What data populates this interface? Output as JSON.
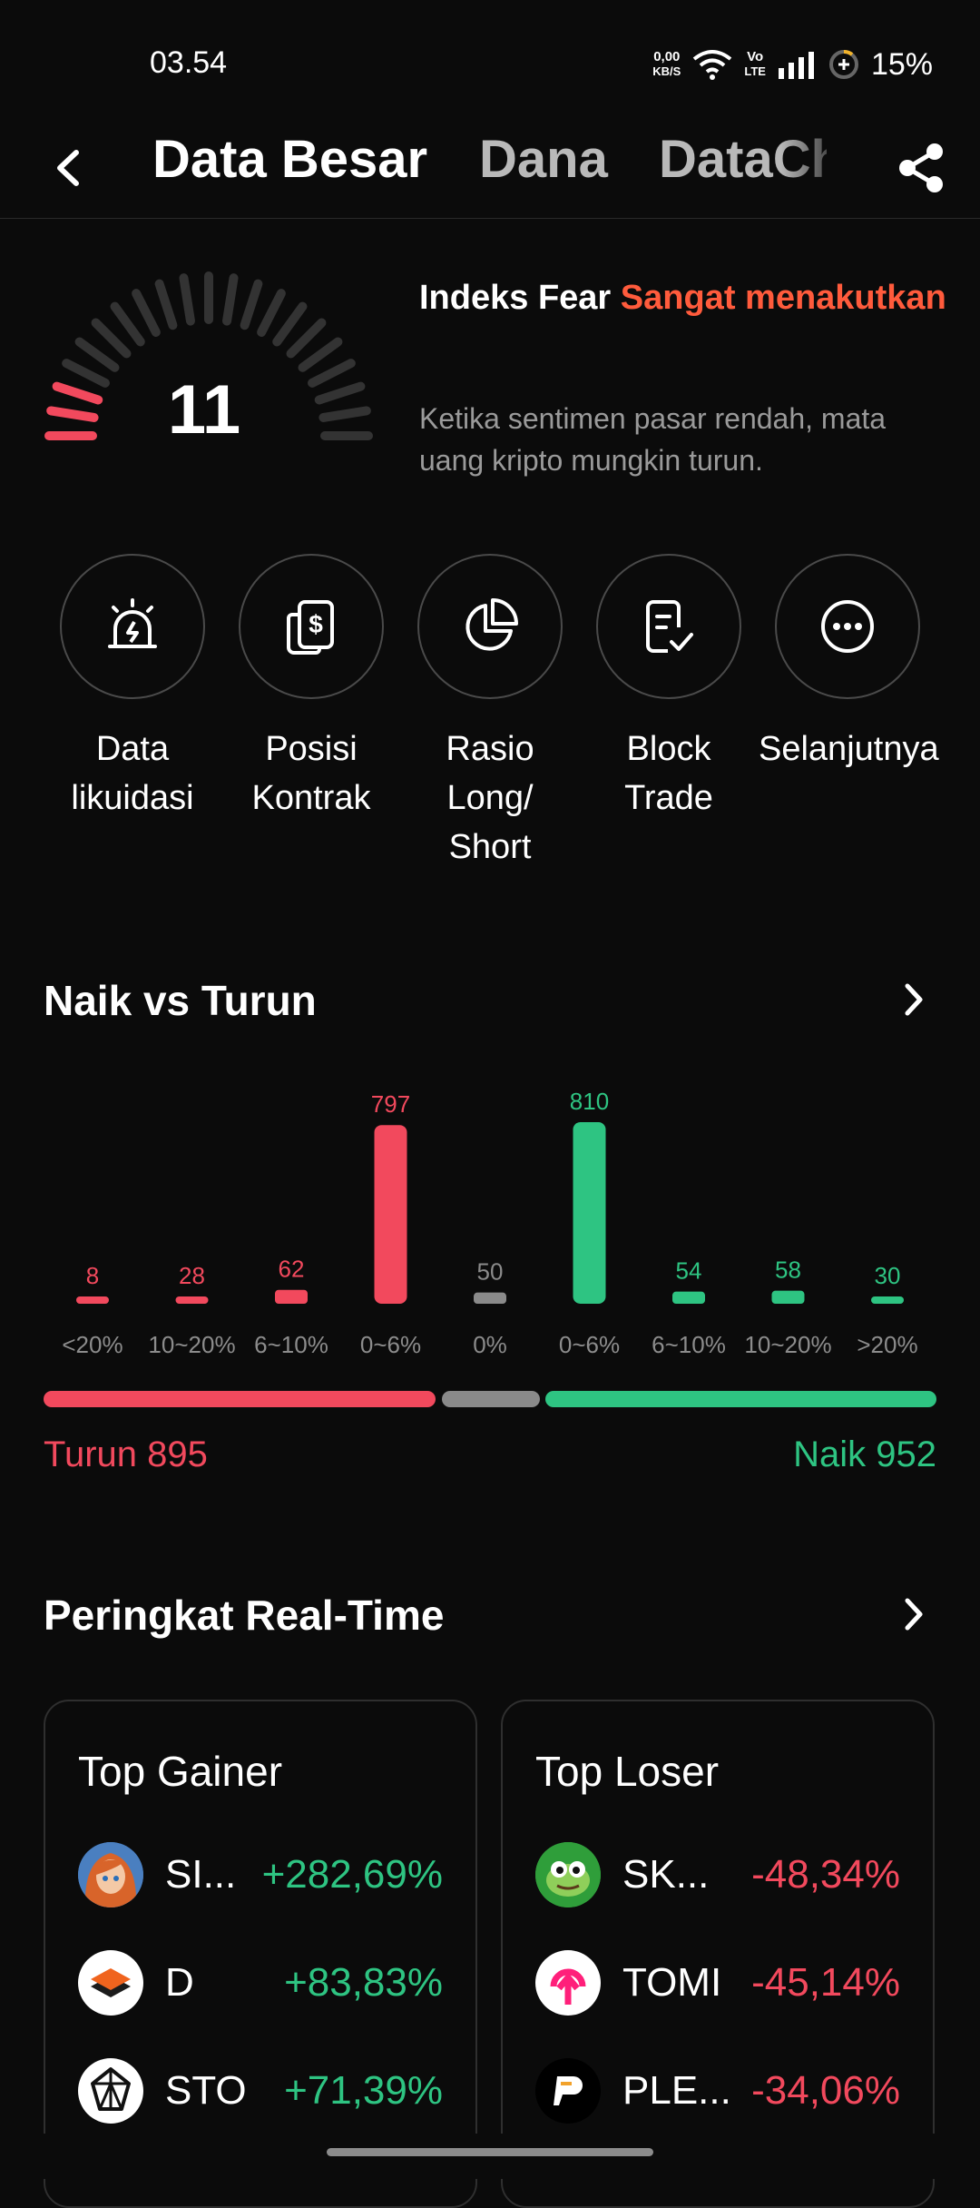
{
  "status_bar": {
    "time": "03.54",
    "net_speed_value": "0,00",
    "net_speed_unit": "KB/S",
    "volte_top": "Vo",
    "volte_bottom": "LTE",
    "battery": "15%"
  },
  "header": {
    "tabs": [
      {
        "label": "Data Besar",
        "active": true
      },
      {
        "label": "Dana",
        "active": false
      },
      {
        "label": "DataCh",
        "active": false
      }
    ],
    "icons": {
      "back": "chevron-left-icon",
      "share": "share-icon"
    }
  },
  "fear_index": {
    "value": "11",
    "title_prefix": "Indeks Fear",
    "level": "Sangat menakutkan",
    "description": "Ketika sentimen pasar rendah, mata uang kripto mungkin turun.",
    "level_color": "#ff5b3c",
    "gauge_filled_segments": 3,
    "gauge_total_segments": 21
  },
  "shortcuts": [
    {
      "label": "Data likuidasi",
      "icon": "alarm-icon"
    },
    {
      "label": "Posisi Kontrak",
      "icon": "dollar-document-icon"
    },
    {
      "label": "Rasio Long/ Short",
      "icon": "pie-chart-icon"
    },
    {
      "label": "Block Trade",
      "icon": "checklist-icon"
    },
    {
      "label": "Selanjutnya",
      "icon": "more-icon"
    }
  ],
  "rise_fall": {
    "title": "Naik vs Turun",
    "down_label": "Turun 895",
    "up_label": "Naik 952",
    "down_total": 895,
    "flat_total": 50,
    "up_total": 952
  },
  "chart_data": {
    "type": "bar",
    "categories": [
      "<20%",
      "10~20%",
      "6~10%",
      "0~6%",
      "0%",
      "0~6%",
      "6~10%",
      "10~20%",
      ">20%"
    ],
    "values": [
      8,
      28,
      62,
      797,
      50,
      810,
      54,
      58,
      30
    ],
    "colors": [
      "#f2495d",
      "#f2495d",
      "#f2495d",
      "#f2495d",
      "#8a8a8a",
      "#2ec482",
      "#2ec482",
      "#2ec482",
      "#2ec482"
    ],
    "title": "Naik vs Turun"
  },
  "ranking": {
    "title": "Peringkat Real-Time",
    "gainers": {
      "title": "Top Gainer",
      "items": [
        {
          "name": "SI...",
          "change": "+282,69%",
          "avatar": "anime-avatar-icon"
        },
        {
          "name": "D",
          "change": "+83,83%",
          "avatar": "stack-logo-icon"
        },
        {
          "name": "STO",
          "change": "+71,39%",
          "avatar": "crystal-logo-icon"
        }
      ]
    },
    "losers": {
      "title": "Top Loser",
      "items": [
        {
          "name": "SK...",
          "change": "-48,34%",
          "avatar": "frog-avatar-icon"
        },
        {
          "name": "TOMI",
          "change": "-45,14%",
          "avatar": "tomi-logo-icon"
        },
        {
          "name": "PLE...",
          "change": "-34,06%",
          "avatar": "p-logo-icon"
        }
      ]
    }
  }
}
